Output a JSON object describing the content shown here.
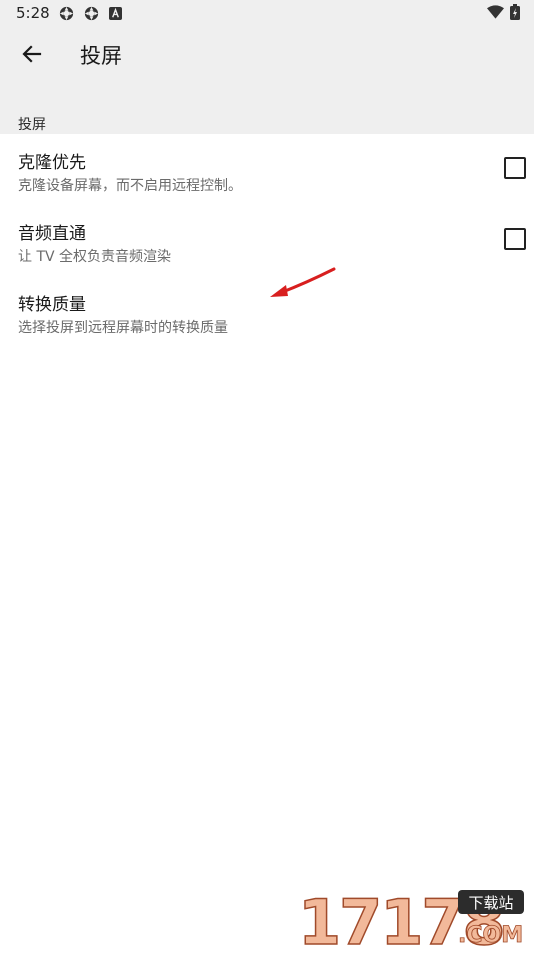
{
  "status_bar": {
    "time": "5:28",
    "left_icons": [
      "settings-gear-icon",
      "settings-gear-icon",
      "android-a-icon"
    ],
    "right_icons": [
      "wifi-icon",
      "battery-charging-icon"
    ]
  },
  "app_bar": {
    "title": "投屏",
    "back_icon": "arrow-back-icon"
  },
  "section": {
    "header": "投屏"
  },
  "preferences": [
    {
      "title": "克隆优先",
      "summary": "克隆设备屏幕，而不启用远程控制。",
      "checked": false
    },
    {
      "title": "音频直通",
      "summary": "让 TV 全权负责音频渲染",
      "checked": false
    },
    {
      "title": "转换质量",
      "summary": "选择投屏到远程屏幕时的转换质量"
    }
  ],
  "annotation": {
    "color": "#d81f1f"
  },
  "watermark": {
    "number": "17178",
    "tag": "下载站",
    "domain": ".COM"
  }
}
